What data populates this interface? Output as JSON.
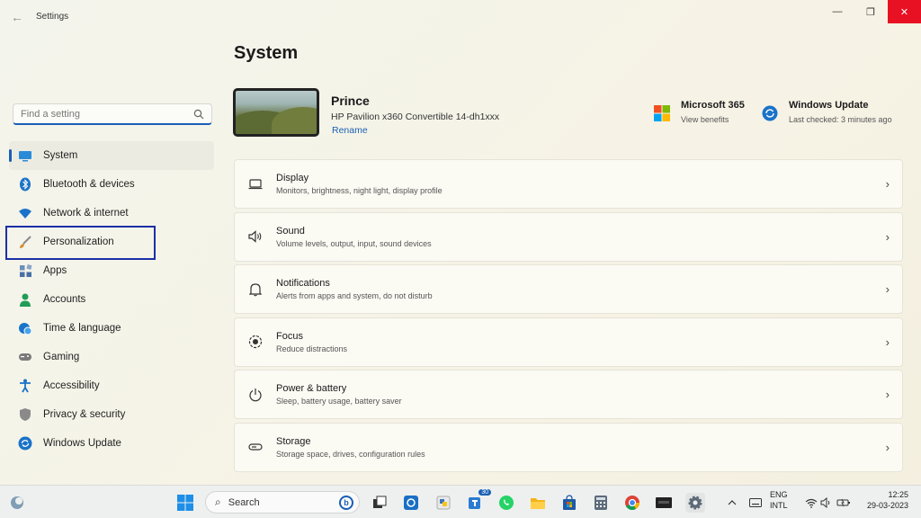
{
  "window": {
    "title": "Settings",
    "controls": {
      "minimize": "—",
      "maximize": "❐",
      "close": "✕"
    }
  },
  "search": {
    "placeholder": "Find a setting"
  },
  "sidebar": {
    "items": [
      {
        "label": "System",
        "icon": "monitor-icon",
        "color": "#1a73c8",
        "active": true
      },
      {
        "label": "Bluetooth & devices",
        "icon": "bluetooth-icon",
        "color": "#1a73c8"
      },
      {
        "label": "Network & internet",
        "icon": "wifi-icon",
        "color": "#1a73c8"
      },
      {
        "label": "Personalization",
        "icon": "paintbrush-icon",
        "color": "#d88a2c"
      },
      {
        "label": "Apps",
        "icon": "apps-icon",
        "color": "#4a6fa5"
      },
      {
        "label": "Accounts",
        "icon": "person-icon",
        "color": "#1f9d55"
      },
      {
        "label": "Time & language",
        "icon": "globe-clock-icon",
        "color": "#1a73c8"
      },
      {
        "label": "Gaming",
        "icon": "gamepad-icon",
        "color": "#777777"
      },
      {
        "label": "Accessibility",
        "icon": "accessibility-icon",
        "color": "#1a73c8"
      },
      {
        "label": "Privacy & security",
        "icon": "shield-icon",
        "color": "#777777"
      },
      {
        "label": "Windows Update",
        "icon": "update-icon",
        "color": "#1a73c8"
      }
    ]
  },
  "main": {
    "title": "System",
    "device": {
      "name": "Prince",
      "model": "HP Pavilion x360 Convertible 14-dh1xxx",
      "rename": "Rename"
    },
    "quick_links": [
      {
        "title": "Microsoft 365",
        "subtitle": "View benefits",
        "icon": "microsoft-logo-icon"
      },
      {
        "title": "Windows Update",
        "subtitle": "Last checked: 3 minutes ago",
        "icon": "update-icon"
      }
    ],
    "cards": [
      {
        "title": "Display",
        "subtitle": "Monitors, brightness, night light, display profile",
        "icon": "display-icon"
      },
      {
        "title": "Sound",
        "subtitle": "Volume levels, output, input, sound devices",
        "icon": "speaker-icon"
      },
      {
        "title": "Notifications",
        "subtitle": "Alerts from apps and system, do not disturb",
        "icon": "bell-icon"
      },
      {
        "title": "Focus",
        "subtitle": "Reduce distractions",
        "icon": "focus-icon"
      },
      {
        "title": "Power & battery",
        "subtitle": "Sleep, battery usage, battery saver",
        "icon": "power-icon"
      },
      {
        "title": "Storage",
        "subtitle": "Storage space, drives, configuration rules",
        "icon": "storage-icon"
      }
    ]
  },
  "taskbar": {
    "search_label": "Search",
    "teams_badge": "30",
    "language_line1": "ENG",
    "language_line2": "INTL",
    "time": "12:25",
    "date": "29-03-2023"
  },
  "colors": {
    "accent": "#1a5fb4",
    "close": "#e81123",
    "highlight": "#1c2fa6"
  }
}
